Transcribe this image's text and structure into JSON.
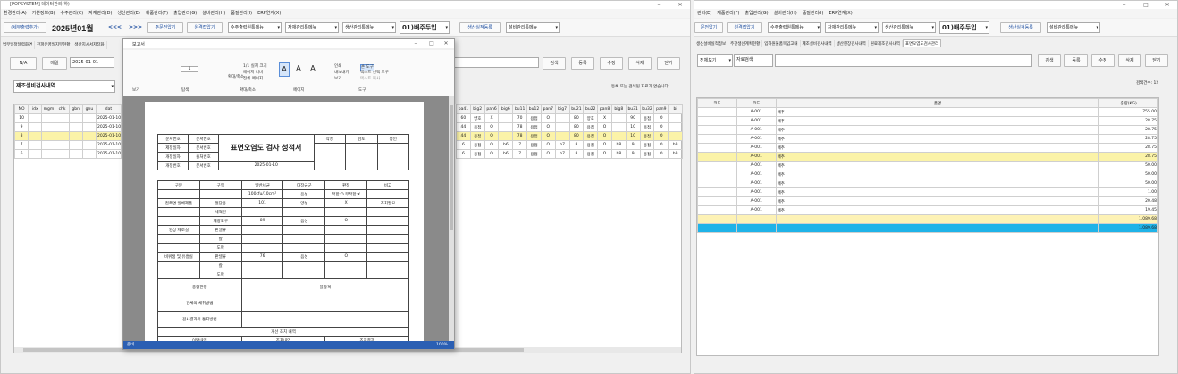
{
  "left": {
    "title": "[POPSYSTEM] 데이터관리(하)",
    "menu": [
      "환경관리(A)",
      "기본정보(B)",
      "수주관리(C)",
      "자재관리(D)",
      "생산관리(E)",
      "재품관리(F)",
      "출입관리(G)",
      "설비관리(H)",
      "품질관리(I)",
      "ERP연계(X)"
    ],
    "toolbar": {
      "calendar_btn": "(세부출력추가)",
      "month": "2025년01월",
      "prev": "<<<",
      "next": ">>>",
      "btn1": "주문전압기",
      "btn2": "원격접압기",
      "sel1": "수주출력원통메뉴",
      "sel2": "자재관리통메뉴",
      "sel3": "생산관리통메뉴",
      "title": "01)배주두입",
      "btn3": "생산실적등록",
      "sel4": "설비관리통메뉴"
    },
    "tabs": [
      "업무일정달력화면",
      "전파운영일지부현황",
      "생산지시서저장화"
    ],
    "actions": {
      "na": "N/A",
      "btn": "메일",
      "date": "2025-01-01"
    },
    "panel_title": "제조설비검사내역",
    "right_btns": [
      "검색",
      "등록",
      "수정",
      "삭제",
      "닫기"
    ],
    "notice": "등록 또는 검색된 자료가 없습니다!",
    "grid": {
      "headers": [
        "NO",
        "idx",
        "mgm",
        "chk",
        "gbn",
        "gnu",
        "dat"
      ],
      "rows": [
        [
          "10",
          "",
          "",
          "",
          "",
          "",
          "2025-01-10"
        ],
        [
          "9",
          "",
          "",
          "",
          "",
          "",
          "2025-01-10"
        ],
        [
          "8",
          "",
          "",
          "",
          "",
          "",
          "2025-01-10"
        ],
        [
          "7",
          "",
          "",
          "",
          "",
          "",
          "2025-01-10"
        ],
        [
          "6",
          "",
          "",
          "",
          "",
          "",
          "2025-01-10"
        ]
      ],
      "right_headers": [
        "pa41",
        "big2",
        "pan6",
        "big6",
        "bu11",
        "bu12",
        "pan7",
        "big7",
        "bu21",
        "bu22",
        "pan8",
        "big8",
        "bu31",
        "bu32",
        "pan9",
        "bi"
      ],
      "right_rows": [
        [
          "60",
          "양호",
          "X",
          "",
          "70",
          "용접",
          "O",
          "",
          "80",
          "양호",
          "X",
          "",
          "90",
          "용접",
          "O",
          ""
        ],
        [
          "44",
          "용접",
          "O",
          "",
          "78",
          "용접",
          "O",
          "",
          "80",
          "용접",
          "O",
          "",
          "10",
          "용접",
          "O",
          ""
        ],
        [
          "44",
          "용접",
          "O",
          "",
          "78",
          "용접",
          "O",
          "",
          "80",
          "용접",
          "O",
          "",
          "10",
          "용접",
          "O",
          ""
        ],
        [
          "6",
          "용접",
          "O",
          "b6",
          "7",
          "용접",
          "O",
          "b7",
          "8",
          "용접",
          "O",
          "b8",
          "9",
          "용접",
          "O",
          "b9"
        ],
        [
          "6",
          "용접",
          "O",
          "b6",
          "7",
          "용접",
          "O",
          "b7",
          "8",
          "용접",
          "O",
          "b8",
          "9",
          "용접",
          "O",
          "b9"
        ]
      ]
    }
  },
  "viewer": {
    "title": "보고서",
    "page_input": "1",
    "ribbon": {
      "g1": "보기",
      "g2": "탐색",
      "g3": "확대/축소",
      "g4": "페이지",
      "g5": "도구",
      "zoom1": "1/1 실제 크기",
      "zoom2": "페이지 너비",
      "zoom3": "전체 페이지",
      "b_fit": "확대/축소",
      "b_find": "찾기",
      "b_a1": "보기",
      "b_a2": "가로",
      "b_a3": "설정",
      "print": "인쇄",
      "export": "내보내기",
      "send": "보기",
      "tools1": "손 도구",
      "tools2": "텍스트 선택 도구",
      "tools3": "텍스트 복사",
      "nav1": "처음",
      "nav2": "뒤로",
      "nav3": "앞으로",
      "nav4": "페이지 검토"
    },
    "status_left": "준비",
    "zoom": "100%",
    "report": {
      "heading": "표면오염도 검사 성적서",
      "approvals": [
        "작성",
        "검토",
        "승인"
      ],
      "doc": [
        [
          "문서번호",
          "문서번호"
        ],
        [
          "제정일자",
          "문서번호"
        ],
        [
          "개정일자",
          "출처번호"
        ],
        [
          "개정번호",
          "문서번호"
        ]
      ],
      "date": "2025-01-10",
      "cols": [
        "구분",
        "구역",
        "일반세균",
        "대장균군",
        "판정",
        "비고"
      ],
      "subcols": [
        "100cfu/10cm²",
        "음성",
        "적합:O 부적합:X"
      ],
      "sections": [
        [
          "일반",
          "접촉면 일체제품",
          "절단용",
          "101",
          "양성",
          "X",
          "조치필요"
        ],
        [
          "",
          "",
          "세척원",
          "",
          "",
          "",
          ""
        ],
        [
          "",
          "",
          "계량도구",
          "89",
          "음성",
          "O",
          ""
        ],
        [
          "점검",
          "영상 제조실",
          "판넬류",
          "",
          "",
          "",
          ""
        ],
        [
          "",
          "",
          "칼",
          "",
          "",
          "",
          ""
        ],
        [
          "",
          "",
          "도마",
          "",
          "",
          "",
          ""
        ],
        [
          "",
          "비위생 및 유흥실",
          "판넬류",
          "76",
          "음성",
          "O",
          ""
        ],
        [
          "",
          "",
          "칼",
          "",
          "",
          "",
          ""
        ],
        [
          "",
          "",
          "도마",
          "",
          "",
          "",
          ""
        ]
      ],
      "summary": [
        [
          "종합판정",
          "불합격"
        ],
        [
          "검체의 채취방법",
          ""
        ],
        [
          "검사결과의 통지방법",
          ""
        ]
      ],
      "action_title": "개선 조치 내역",
      "action_cols": [
        "이탈내역",
        "조치내역",
        "조치결과"
      ]
    }
  },
  "right": {
    "menu": [
      "관리(E)",
      "재품관리(F)",
      "출입관리(G)",
      "설비관리(H)",
      "품질관리(I)",
      "ERP연계(X)"
    ],
    "toolbar": {
      "btn1": "문전압기",
      "btn2": "원격접압기",
      "sel1": "수주출력원통메뉴",
      "sel2": "자재관리통메뉴",
      "sel3": "생산관리통메뉴",
      "title": "01)배주두입",
      "btn3": "생산실적등록",
      "sel4": "설비관리통메뉴"
    },
    "tabs": [
      "생산설비실적정보",
      "주간생산계획현황",
      "입하원물품목입고내",
      "제조설비검사내역",
      "생산현장검사내역",
      "원료제조검사내역",
      "표면오염도검사관리"
    ],
    "filter": {
      "sel": "전체보기",
      "input": "자료검색"
    },
    "right_btns": [
      "검색",
      "등록",
      "수정",
      "삭제",
      "닫기"
    ],
    "count": "검색건수: 12",
    "grid": {
      "headers": [
        "코드",
        "코드",
        "품명",
        "중량(KG)"
      ],
      "rows": [
        [
          "",
          "A-001",
          "배추",
          "755.00"
        ],
        [
          "",
          "A-001",
          "배추",
          "28.75"
        ],
        [
          "",
          "A-001",
          "배추",
          "28.75"
        ],
        [
          "",
          "A-001",
          "배추",
          "28.75"
        ],
        [
          "",
          "A-001",
          "배추",
          "28.75"
        ],
        [
          "",
          "A-001",
          "배추",
          "28.75"
        ],
        [
          "",
          "A-001",
          "배추",
          "50.00"
        ],
        [
          "",
          "A-001",
          "배추",
          "50.00"
        ],
        [
          "",
          "A-001",
          "배추",
          "50.00"
        ],
        [
          "",
          "A-001",
          "배추",
          "1.00"
        ],
        [
          "",
          "A-001",
          "배추",
          "20.48"
        ],
        [
          "",
          "A-001",
          "배추",
          "19.45"
        ]
      ],
      "total1": "1,089.68",
      "total2": "1,089.68"
    }
  }
}
